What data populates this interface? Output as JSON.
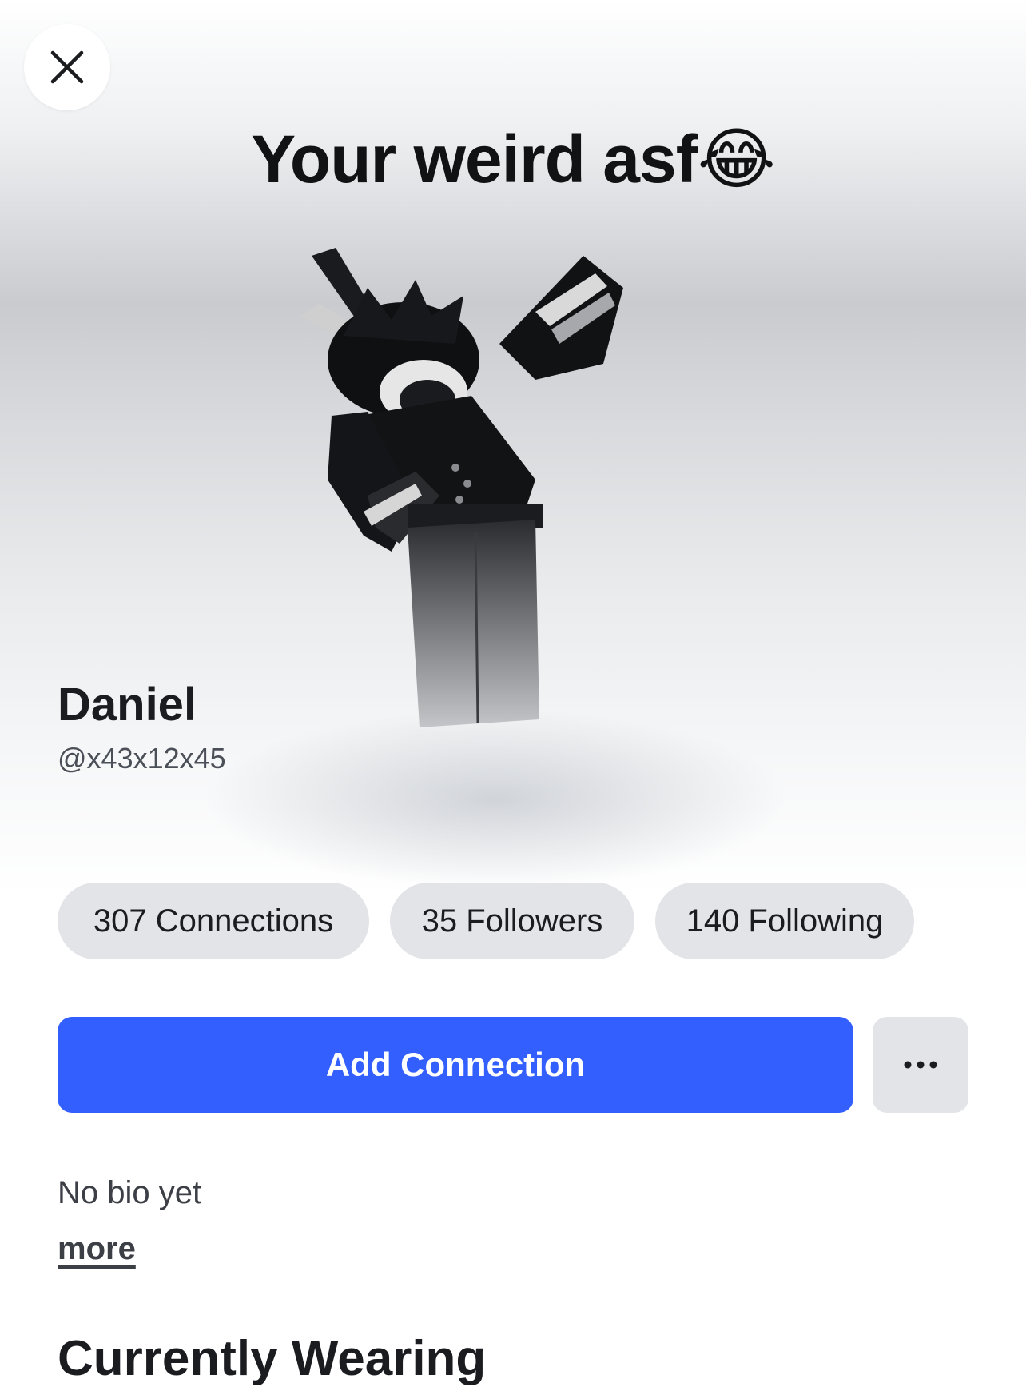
{
  "profile": {
    "status": "Your weird asf😂",
    "display_name": "Daniel",
    "username": "@x43x12x45",
    "bio": "No bio yet",
    "more_label": "more"
  },
  "stats": {
    "connections_label": "307 Connections",
    "followers_label": "35 Followers",
    "following_label": "140 Following"
  },
  "actions": {
    "add_connection_label": "Add Connection",
    "more_options_icon": "ellipsis-icon",
    "close_icon": "close-icon"
  },
  "sections": {
    "currently_wearing_title": "Currently Wearing"
  },
  "colors": {
    "primary_button": "#335fff",
    "pill_background": "#e3e4e8"
  }
}
